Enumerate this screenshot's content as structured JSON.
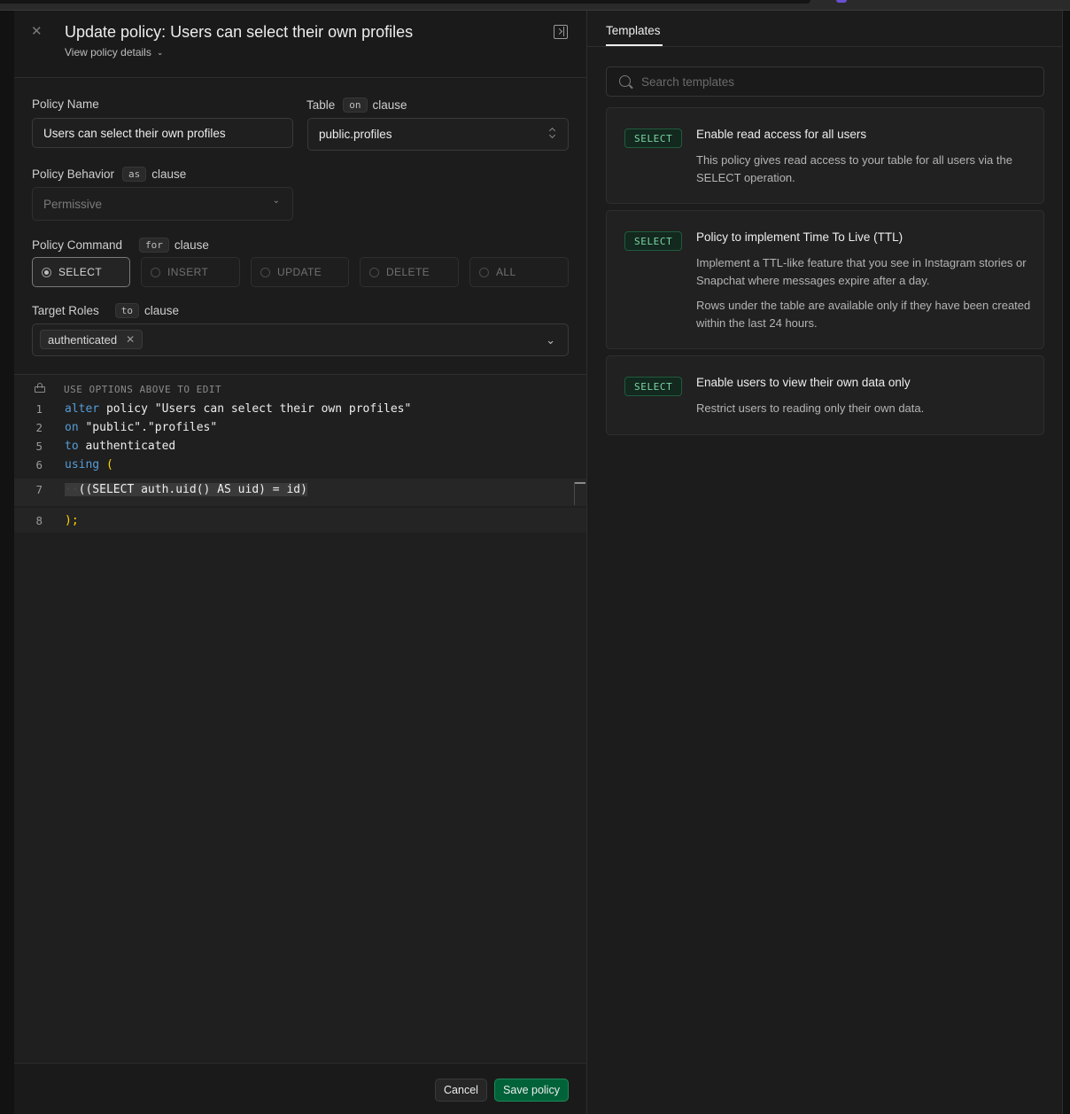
{
  "header": {
    "title": "Update policy: Users can select their own profiles",
    "details_label": "View policy details"
  },
  "form": {
    "policy_name_label": "Policy Name",
    "policy_name_value": "Users can select their own profiles",
    "table_label": "Table",
    "table_clause_code": "on",
    "table_clause_suffix": "clause",
    "table_value": "public.profiles",
    "behavior_label": "Policy Behavior",
    "behavior_clause_code": "as",
    "behavior_clause_suffix": "clause",
    "behavior_value": "Permissive",
    "command_label": "Policy Command",
    "command_clause_code": "for",
    "command_clause_suffix": "clause",
    "commands": [
      {
        "label": "SELECT",
        "selected": true
      },
      {
        "label": "INSERT",
        "selected": false
      },
      {
        "label": "UPDATE",
        "selected": false
      },
      {
        "label": "DELETE",
        "selected": false
      },
      {
        "label": "ALL",
        "selected": false
      }
    ],
    "roles_label": "Target Roles",
    "roles_clause_code": "to",
    "roles_clause_suffix": "clause",
    "roles": [
      "authenticated"
    ]
  },
  "editor": {
    "hint": "USE OPTIONS ABOVE TO EDIT",
    "lines": [
      {
        "num": "1",
        "kw": "alter",
        "rest": " policy \"Users can select their own profiles\""
      },
      {
        "num": "2",
        "kw": "on",
        "rest": " \"public\".\"profiles\""
      },
      {
        "num": "5",
        "kw": "to",
        "rest": " authenticated"
      },
      {
        "num": "6",
        "kw": "using",
        "rest": " ("
      },
      {
        "num": "7",
        "kw": "",
        "rest": "((SELECT auth.uid() AS uid) = id)"
      },
      {
        "num": "8",
        "kw": "",
        "rest": ");"
      }
    ]
  },
  "footer": {
    "cancel_label": "Cancel",
    "save_label": "Save policy"
  },
  "templates": {
    "tab_label": "Templates",
    "search_placeholder": "Search templates",
    "items": [
      {
        "badge": "SELECT",
        "title": "Enable read access for all users",
        "desc": [
          "This policy gives read access to your table for all users via the SELECT operation."
        ]
      },
      {
        "badge": "SELECT",
        "title": "Policy to implement Time To Live (TTL)",
        "desc": [
          "Implement a TTL-like feature that you see in Instagram stories or Snapchat where messages expire after a day.",
          "Rows under the table are available only if they have been created within the last 24 hours."
        ]
      },
      {
        "badge": "SELECT",
        "title": "Enable users to view their own data only",
        "desc": [
          "Restrict users to reading only their own data."
        ]
      }
    ]
  },
  "colors": {
    "accent_green": "#006239",
    "badge_green": "#7ad4a4",
    "keyword_blue": "#569cd6",
    "paren_yellow": "#ffd700"
  }
}
